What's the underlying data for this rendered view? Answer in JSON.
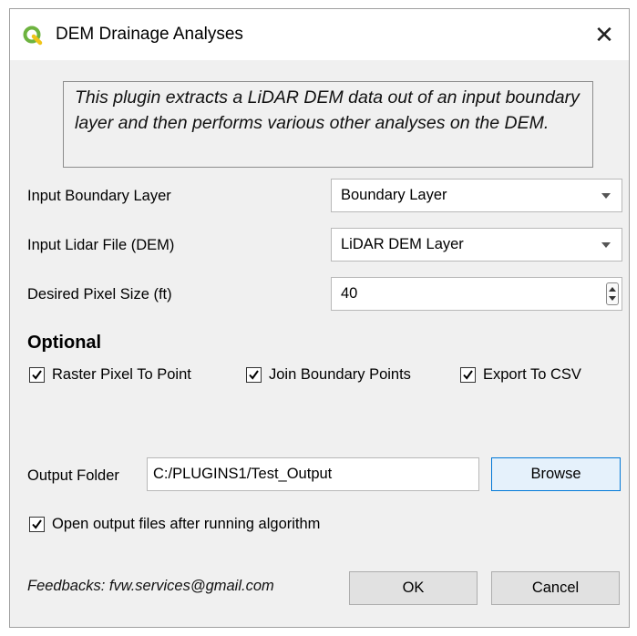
{
  "window": {
    "title": "DEM Drainage Analyses",
    "close_symbol": "✕",
    "app_icon": "qgis-icon"
  },
  "description": "This plugin extracts a LiDAR DEM data out of an input boundary layer and then performs various other analyses on the DEM.",
  "fields": {
    "boundary_label": "Input Boundary Layer",
    "boundary_value": "Boundary Layer",
    "lidar_label": "Input Lidar File (DEM)",
    "lidar_value": "LiDAR DEM Layer",
    "pixel_label": "Desired Pixel Size (ft)",
    "pixel_value": "40"
  },
  "optional": {
    "title": "Optional",
    "options": [
      {
        "label": "Raster Pixel To Point",
        "checked": true
      },
      {
        "label": "Join Boundary Points",
        "checked": true
      },
      {
        "label": "Export To CSV",
        "checked": true
      }
    ]
  },
  "output": {
    "label": "Output Folder",
    "value": "C:/PLUGINS1/Test_Output",
    "browse_label": "Browse",
    "open_files_label": "Open output files after running algorithm",
    "open_files_checked": true
  },
  "footer": {
    "feedback": "Feedbacks: fvw.services@gmail.com",
    "ok_label": "OK",
    "cancel_label": "Cancel"
  },
  "colors": {
    "qgis_green": "#6db33f",
    "qgis_yellow": "#f0c419",
    "focus_border": "#0078d7"
  }
}
